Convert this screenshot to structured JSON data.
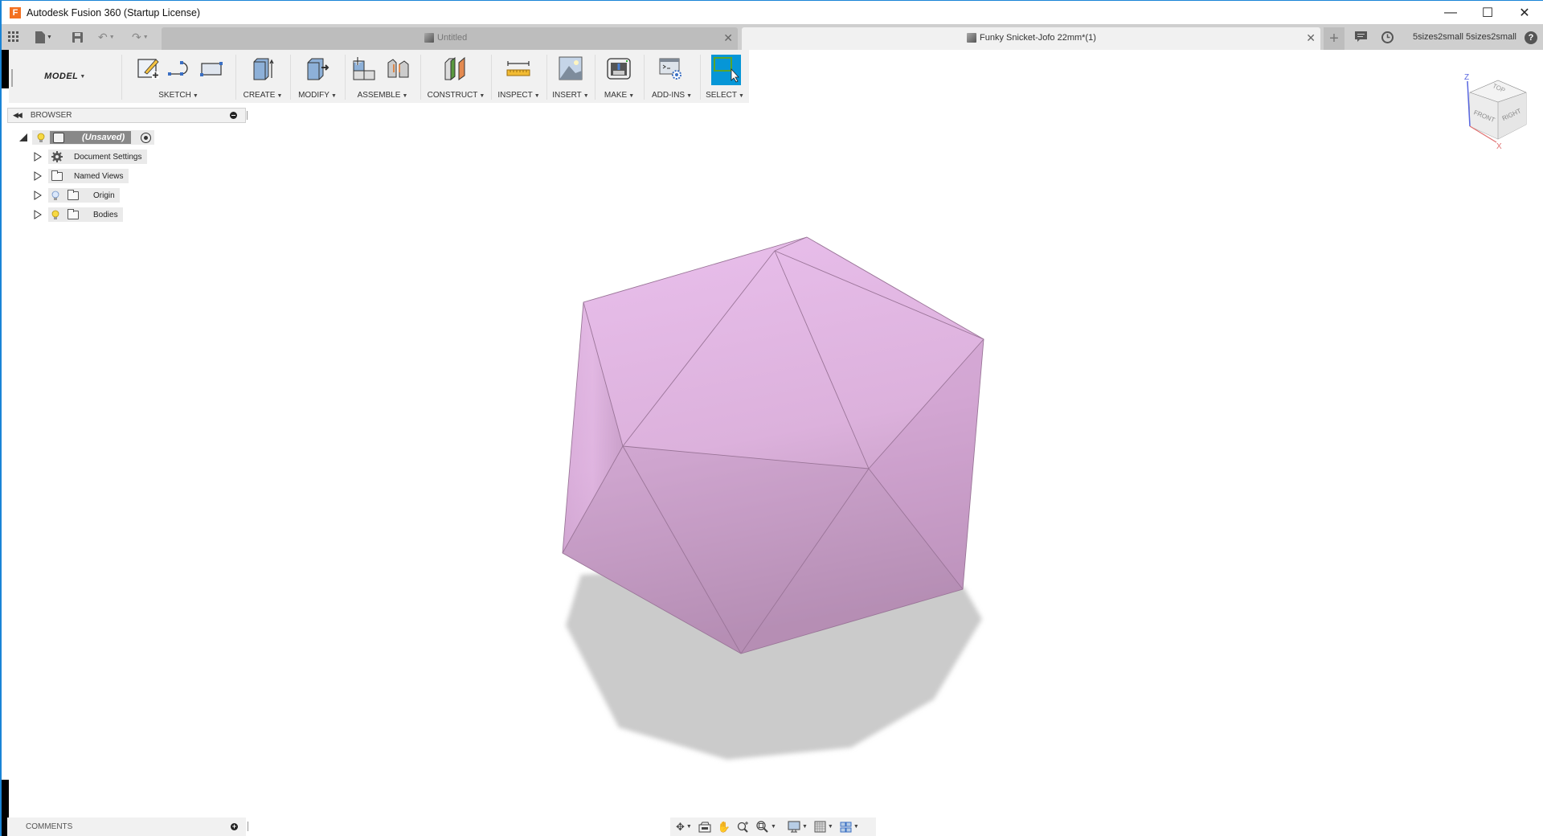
{
  "window": {
    "title": "Autodesk Fusion 360 (Startup License)",
    "logo_letter": "F",
    "controls": [
      "minimize",
      "maximize",
      "close"
    ]
  },
  "tabs": [
    {
      "label": "Untitled",
      "active": false
    },
    {
      "label": "Funky Snicket-Jofo 22mm*(1)",
      "active": true
    }
  ],
  "user": {
    "name": "5sizes2small 5sizes2small"
  },
  "toolbar": {
    "workspace": "MODEL",
    "groups": [
      {
        "label": "SKETCH"
      },
      {
        "label": "CREATE"
      },
      {
        "label": "MODIFY"
      },
      {
        "label": "ASSEMBLE"
      },
      {
        "label": "CONSTRUCT"
      },
      {
        "label": "INSPECT"
      },
      {
        "label": "INSERT"
      },
      {
        "label": "MAKE"
      },
      {
        "label": "ADD-INS"
      },
      {
        "label": "SELECT"
      }
    ],
    "select_color": "#0696d7"
  },
  "browser": {
    "title": "BROWSER",
    "root": {
      "label": "(Unsaved)"
    },
    "items": [
      {
        "label": "Document Settings",
        "icon": "gear-icon"
      },
      {
        "label": "Named Views",
        "icon": "folder-icon"
      },
      {
        "label": "Origin",
        "icon": "folder-icon",
        "visibility": "hidden"
      },
      {
        "label": "Bodies",
        "icon": "folder-icon",
        "visibility": "visible"
      }
    ]
  },
  "comments": {
    "title": "COMMENTS"
  },
  "viewcube": {
    "faces": [
      "TOP",
      "FRONT",
      "RIGHT"
    ],
    "axes": [
      "Z",
      "X"
    ]
  },
  "model": {
    "shape": "icosahedron",
    "color": "#e2b8e3"
  }
}
